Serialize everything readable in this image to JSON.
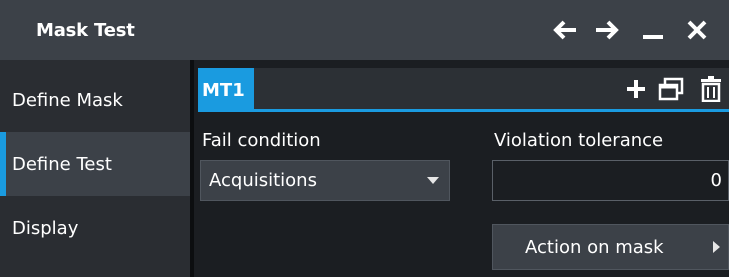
{
  "window": {
    "title": "Mask Test",
    "controls": [
      {
        "name": "back-arrow-icon"
      },
      {
        "name": "forward-arrow-icon"
      },
      {
        "name": "minimize-icon"
      },
      {
        "name": "close-icon"
      }
    ]
  },
  "sidebar": {
    "items": [
      {
        "label": "Define Mask",
        "active": false
      },
      {
        "label": "Define Test",
        "active": true
      },
      {
        "label": "Display",
        "active": false
      }
    ]
  },
  "tabs": {
    "items": [
      {
        "label": "MT1",
        "active": true
      }
    ],
    "tools": [
      {
        "name": "add-icon"
      },
      {
        "name": "copy-window-icon"
      },
      {
        "name": "delete-icon"
      }
    ]
  },
  "form": {
    "fail_condition": {
      "label": "Fail condition",
      "value": "Acquisitions"
    },
    "violation_tolerance": {
      "label": "Violation tolerance",
      "value": "0"
    },
    "action_button": "Action on mask"
  },
  "colors": {
    "accent": "#1a9be0",
    "titlebar": "#3c4148",
    "sidebar": "#2a2d32",
    "background": "#1b1e22"
  }
}
